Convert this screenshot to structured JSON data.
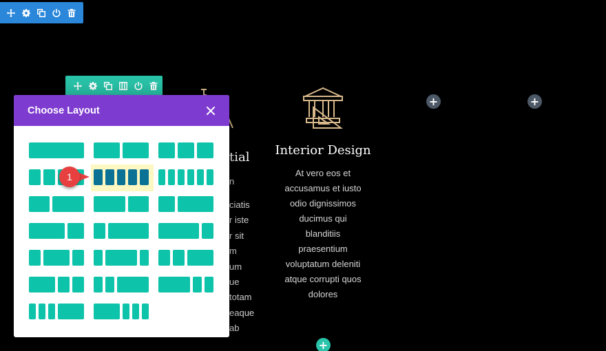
{
  "modal": {
    "title": "Choose Layout",
    "selected_option": "5 equal columns"
  },
  "columns": {
    "partial_title": "tial",
    "partial_subtitle": "n",
    "partial_lines": [
      "ciatis",
      "r iste",
      "r sit",
      "m",
      "um",
      "ue",
      "totam",
      "eaque",
      "ab"
    ],
    "interior": {
      "title": "Interior Design",
      "body_lines": [
        "At vero eos et",
        "accusamus et iusto",
        "odio dignissimos",
        "ducimus qui",
        "blanditiis",
        "praesentium",
        "voluptatum deleniti",
        "atque corrupti quos",
        "dolores"
      ]
    }
  },
  "annotation": {
    "step_number": "1"
  },
  "add_symbol": "+",
  "icons": {
    "section_toolbar": [
      "move-icon",
      "gear-icon",
      "duplicate-icon",
      "power-icon",
      "trash-icon"
    ],
    "row_toolbar": [
      "move-icon",
      "gear-icon",
      "duplicate-icon",
      "columns-icon",
      "power-icon",
      "trash-icon"
    ],
    "column_icon": "bank-building-icon"
  },
  "colors": {
    "section_toolbar": "#2b87da",
    "row_toolbar": "#29c4a9",
    "modal_header": "#7e3bd0",
    "layout_block": "#0dc3a9",
    "selected_block": "#0b7296",
    "selected_highlight": "#fdf7c2",
    "step_badge": "#e84040",
    "accent_icon": "#d8b98b"
  }
}
